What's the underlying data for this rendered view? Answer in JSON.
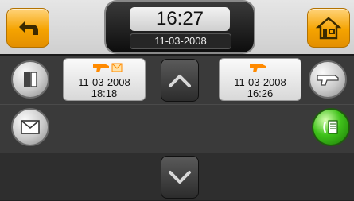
{
  "header": {
    "time": "16:27",
    "date": "11-03-2008"
  },
  "icons": {
    "back": "back-arrow-icon",
    "home": "home-icon",
    "contacts": "contacts-book-icon",
    "message": "envelope-icon",
    "alarm_left": "alarm-gun-icon",
    "message_flag": "envelope-icon",
    "alarm_right": "alarm-gun-icon",
    "alarm_settings": "alarm-gun-icon",
    "call_log": "phone-log-icon",
    "scroll_up": "chevron-up-icon",
    "scroll_down": "chevron-down-icon"
  },
  "events": [
    {
      "date": "11-03-2008",
      "time": "18:18",
      "has_message": true
    },
    {
      "date": "11-03-2008",
      "time": "16:26",
      "has_message": false
    }
  ],
  "colors": {
    "accent": "#f5a300",
    "alarm_orange": "#ff8a00",
    "call_green": "#3fc21a"
  }
}
